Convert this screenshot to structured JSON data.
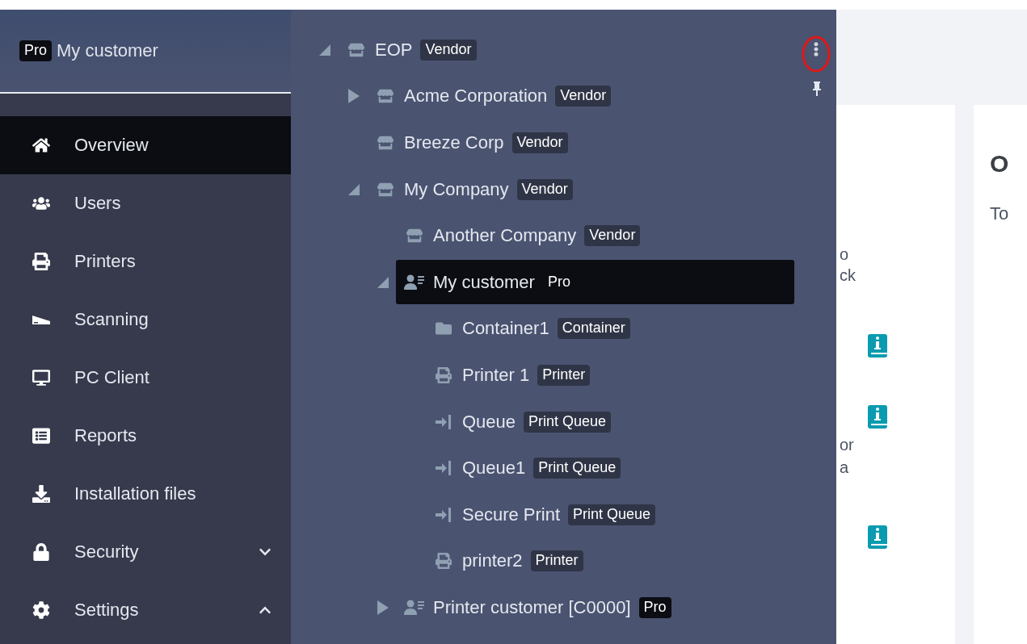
{
  "sidebar": {
    "header": {
      "badge": "Pro",
      "title": "My customer"
    },
    "items": [
      {
        "label": "Overview",
        "kind": "home",
        "selected": true
      },
      {
        "label": "Users",
        "kind": "users",
        "selected": false
      },
      {
        "label": "Printers",
        "kind": "printers",
        "selected": false
      },
      {
        "label": "Scanning",
        "kind": "scanning",
        "selected": false
      },
      {
        "label": "PC Client",
        "kind": "desktop",
        "selected": false
      },
      {
        "label": "Reports",
        "kind": "reports",
        "selected": false
      },
      {
        "label": "Installation files",
        "kind": "download",
        "selected": false
      },
      {
        "label": "Security",
        "kind": "security",
        "selected": false,
        "expanded": false
      },
      {
        "label": "Settings",
        "kind": "settings",
        "selected": false,
        "expanded": true
      }
    ]
  },
  "tree": {
    "items": [
      {
        "label": "EOP",
        "badge": "Vendor",
        "kind": "vendor",
        "expanded": true,
        "selected": false,
        "children": [
          {
            "label": "Acme Corporation",
            "badge": "Vendor",
            "kind": "vendor",
            "expanded": false,
            "selected": false
          },
          {
            "label": "Breeze Corp",
            "badge": "Vendor",
            "kind": "vendor",
            "selected": false
          },
          {
            "label": "My Company",
            "badge": "Vendor",
            "kind": "vendor",
            "expanded": true,
            "selected": false,
            "children": [
              {
                "label": "Another Company",
                "badge": "Vendor",
                "kind": "vendor",
                "selected": false
              },
              {
                "label": "My customer",
                "badge": "Pro",
                "kind": "customer",
                "expanded": true,
                "selected": true,
                "children": [
                  {
                    "label": "Container1",
                    "badge": "Container",
                    "kind": "container",
                    "selected": false
                  },
                  {
                    "label": "Printer 1",
                    "badge": "Printer",
                    "kind": "printer",
                    "selected": false
                  },
                  {
                    "label": "Queue",
                    "badge": "Print Queue",
                    "kind": "queue",
                    "selected": false
                  },
                  {
                    "label": "Queue1",
                    "badge": "Print Queue",
                    "kind": "queue",
                    "selected": false
                  },
                  {
                    "label": "Secure Print",
                    "badge": "Print Queue",
                    "kind": "queue",
                    "selected": false
                  },
                  {
                    "label": "printer2",
                    "badge": "Printer",
                    "kind": "printer",
                    "selected": false
                  }
                ]
              },
              {
                "label": "Printer customer [C0000]",
                "badge": "Pro",
                "kind": "customer",
                "expanded": false,
                "selected": false
              }
            ]
          }
        ]
      }
    ]
  },
  "content": {
    "card_1": {
      "texts": [
        "o",
        "ck",
        "or",
        "a"
      ]
    },
    "card_2": {
      "heading": "O",
      "text": "To"
    }
  }
}
